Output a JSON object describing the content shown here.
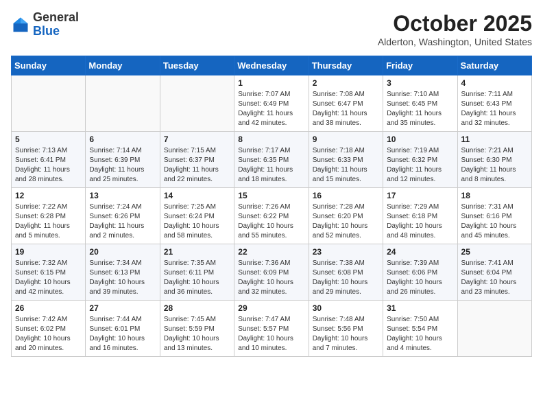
{
  "header": {
    "logo_general": "General",
    "logo_blue": "Blue",
    "month_title": "October 2025",
    "location": "Alderton, Washington, United States"
  },
  "weekdays": [
    "Sunday",
    "Monday",
    "Tuesday",
    "Wednesday",
    "Thursday",
    "Friday",
    "Saturday"
  ],
  "weeks": [
    [
      {
        "day": "",
        "info": ""
      },
      {
        "day": "",
        "info": ""
      },
      {
        "day": "",
        "info": ""
      },
      {
        "day": "1",
        "info": "Sunrise: 7:07 AM\nSunset: 6:49 PM\nDaylight: 11 hours\nand 42 minutes."
      },
      {
        "day": "2",
        "info": "Sunrise: 7:08 AM\nSunset: 6:47 PM\nDaylight: 11 hours\nand 38 minutes."
      },
      {
        "day": "3",
        "info": "Sunrise: 7:10 AM\nSunset: 6:45 PM\nDaylight: 11 hours\nand 35 minutes."
      },
      {
        "day": "4",
        "info": "Sunrise: 7:11 AM\nSunset: 6:43 PM\nDaylight: 11 hours\nand 32 minutes."
      }
    ],
    [
      {
        "day": "5",
        "info": "Sunrise: 7:13 AM\nSunset: 6:41 PM\nDaylight: 11 hours\nand 28 minutes."
      },
      {
        "day": "6",
        "info": "Sunrise: 7:14 AM\nSunset: 6:39 PM\nDaylight: 11 hours\nand 25 minutes."
      },
      {
        "day": "7",
        "info": "Sunrise: 7:15 AM\nSunset: 6:37 PM\nDaylight: 11 hours\nand 22 minutes."
      },
      {
        "day": "8",
        "info": "Sunrise: 7:17 AM\nSunset: 6:35 PM\nDaylight: 11 hours\nand 18 minutes."
      },
      {
        "day": "9",
        "info": "Sunrise: 7:18 AM\nSunset: 6:33 PM\nDaylight: 11 hours\nand 15 minutes."
      },
      {
        "day": "10",
        "info": "Sunrise: 7:19 AM\nSunset: 6:32 PM\nDaylight: 11 hours\nand 12 minutes."
      },
      {
        "day": "11",
        "info": "Sunrise: 7:21 AM\nSunset: 6:30 PM\nDaylight: 11 hours\nand 8 minutes."
      }
    ],
    [
      {
        "day": "12",
        "info": "Sunrise: 7:22 AM\nSunset: 6:28 PM\nDaylight: 11 hours\nand 5 minutes."
      },
      {
        "day": "13",
        "info": "Sunrise: 7:24 AM\nSunset: 6:26 PM\nDaylight: 11 hours\nand 2 minutes."
      },
      {
        "day": "14",
        "info": "Sunrise: 7:25 AM\nSunset: 6:24 PM\nDaylight: 10 hours\nand 58 minutes."
      },
      {
        "day": "15",
        "info": "Sunrise: 7:26 AM\nSunset: 6:22 PM\nDaylight: 10 hours\nand 55 minutes."
      },
      {
        "day": "16",
        "info": "Sunrise: 7:28 AM\nSunset: 6:20 PM\nDaylight: 10 hours\nand 52 minutes."
      },
      {
        "day": "17",
        "info": "Sunrise: 7:29 AM\nSunset: 6:18 PM\nDaylight: 10 hours\nand 48 minutes."
      },
      {
        "day": "18",
        "info": "Sunrise: 7:31 AM\nSunset: 6:16 PM\nDaylight: 10 hours\nand 45 minutes."
      }
    ],
    [
      {
        "day": "19",
        "info": "Sunrise: 7:32 AM\nSunset: 6:15 PM\nDaylight: 10 hours\nand 42 minutes."
      },
      {
        "day": "20",
        "info": "Sunrise: 7:34 AM\nSunset: 6:13 PM\nDaylight: 10 hours\nand 39 minutes."
      },
      {
        "day": "21",
        "info": "Sunrise: 7:35 AM\nSunset: 6:11 PM\nDaylight: 10 hours\nand 36 minutes."
      },
      {
        "day": "22",
        "info": "Sunrise: 7:36 AM\nSunset: 6:09 PM\nDaylight: 10 hours\nand 32 minutes."
      },
      {
        "day": "23",
        "info": "Sunrise: 7:38 AM\nSunset: 6:08 PM\nDaylight: 10 hours\nand 29 minutes."
      },
      {
        "day": "24",
        "info": "Sunrise: 7:39 AM\nSunset: 6:06 PM\nDaylight: 10 hours\nand 26 minutes."
      },
      {
        "day": "25",
        "info": "Sunrise: 7:41 AM\nSunset: 6:04 PM\nDaylight: 10 hours\nand 23 minutes."
      }
    ],
    [
      {
        "day": "26",
        "info": "Sunrise: 7:42 AM\nSunset: 6:02 PM\nDaylight: 10 hours\nand 20 minutes."
      },
      {
        "day": "27",
        "info": "Sunrise: 7:44 AM\nSunset: 6:01 PM\nDaylight: 10 hours\nand 16 minutes."
      },
      {
        "day": "28",
        "info": "Sunrise: 7:45 AM\nSunset: 5:59 PM\nDaylight: 10 hours\nand 13 minutes."
      },
      {
        "day": "29",
        "info": "Sunrise: 7:47 AM\nSunset: 5:57 PM\nDaylight: 10 hours\nand 10 minutes."
      },
      {
        "day": "30",
        "info": "Sunrise: 7:48 AM\nSunset: 5:56 PM\nDaylight: 10 hours\nand 7 minutes."
      },
      {
        "day": "31",
        "info": "Sunrise: 7:50 AM\nSunset: 5:54 PM\nDaylight: 10 hours\nand 4 minutes."
      },
      {
        "day": "",
        "info": ""
      }
    ]
  ]
}
